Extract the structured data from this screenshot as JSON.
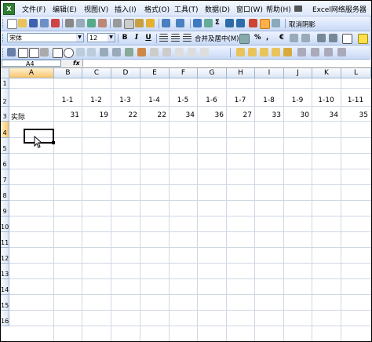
{
  "menu": [
    "文件(F)",
    "编辑(E)",
    "视图(V)",
    "插入(I)",
    "格式(O)",
    "工具(T)",
    "数据(D)",
    "窗口(W)",
    "帮助(H)",
    "Excel网络服务器"
  ],
  "toolbar": {
    "right_label": "取消阴影",
    "font_name": "宋体",
    "font_size": "12",
    "bold": "B",
    "italic": "I",
    "underline": "U",
    "merge_center": "合并及居中(M)",
    "sigma": "Σ",
    "percent": "%",
    "euro": "€",
    "dropdown_arrow": "▼"
  },
  "formula_bar": {
    "name_box": "A4",
    "fx": "fx",
    "value": ""
  },
  "columns": [
    "A",
    "B",
    "C",
    "D",
    "E",
    "F",
    "G",
    "H",
    "I",
    "J",
    "K",
    "L"
  ],
  "rows": [
    "1",
    "2",
    "3",
    "4",
    "5",
    "6",
    "7",
    "8",
    "9",
    "10",
    "11",
    "12",
    "13",
    "14",
    "15",
    "16"
  ],
  "sheet": {
    "row2": [
      "",
      "1-1",
      "1-2",
      "1-3",
      "1-4",
      "1-5",
      "1-6",
      "1-7",
      "1-8",
      "1-9",
      "1-10",
      "1-11"
    ],
    "row3": [
      "实际",
      "31",
      "19",
      "22",
      "22",
      "34",
      "36",
      "27",
      "33",
      "30",
      "34",
      "35"
    ]
  },
  "selected_cell": "A4",
  "colors": {
    "toolbar_top": "#eef4ff",
    "toolbar_bottom": "#c9daf5",
    "header_selected": "#f7c46c",
    "gridline": "#d0d7e5"
  }
}
